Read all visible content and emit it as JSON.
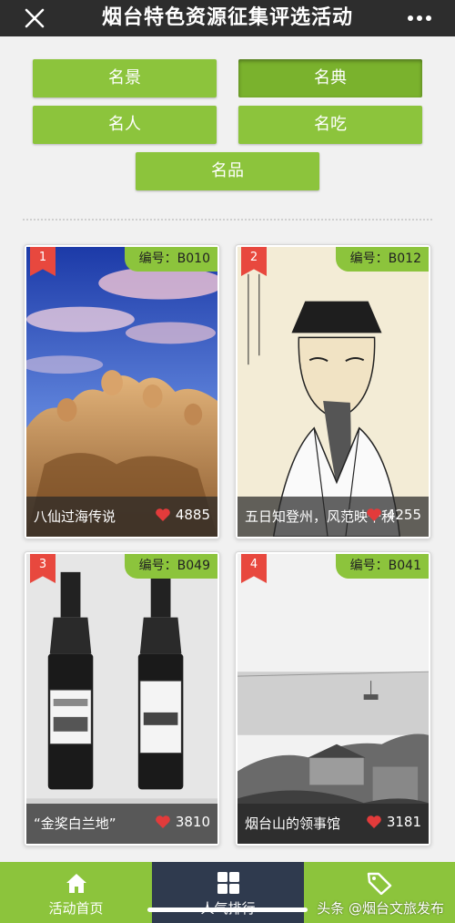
{
  "header": {
    "title": "烟台特色资源征集评选活动"
  },
  "categories": [
    {
      "label": "名景"
    },
    {
      "label": "名典"
    },
    {
      "label": "名人"
    },
    {
      "label": "名吃"
    },
    {
      "label": "名品"
    }
  ],
  "cards": [
    {
      "rank": "1",
      "code": "编号：B010",
      "caption": "八仙过海传说",
      "votes": "4885"
    },
    {
      "rank": "2",
      "code": "编号：B012",
      "caption": "五日知登州，风范映千秋",
      "votes": "4255"
    },
    {
      "rank": "3",
      "code": "编号：B049",
      "caption": "“金奖白兰地”",
      "votes": "3810"
    },
    {
      "rank": "4",
      "code": "编号：B041",
      "caption": "烟台山的领事馆",
      "votes": "3181"
    }
  ],
  "nav": [
    {
      "label": "活动首页",
      "icon": "home-icon"
    },
    {
      "label": "人气排行",
      "icon": "grid-icon"
    },
    {
      "label": "",
      "icon": "tag-icon"
    }
  ],
  "watermark": "头条 @烟台文旅发布",
  "colors": {
    "accent": "#8cc43c",
    "topbar": "#2d2d2d",
    "rank_badge": "#e8483e",
    "nav_active": "#2f3a4e"
  }
}
